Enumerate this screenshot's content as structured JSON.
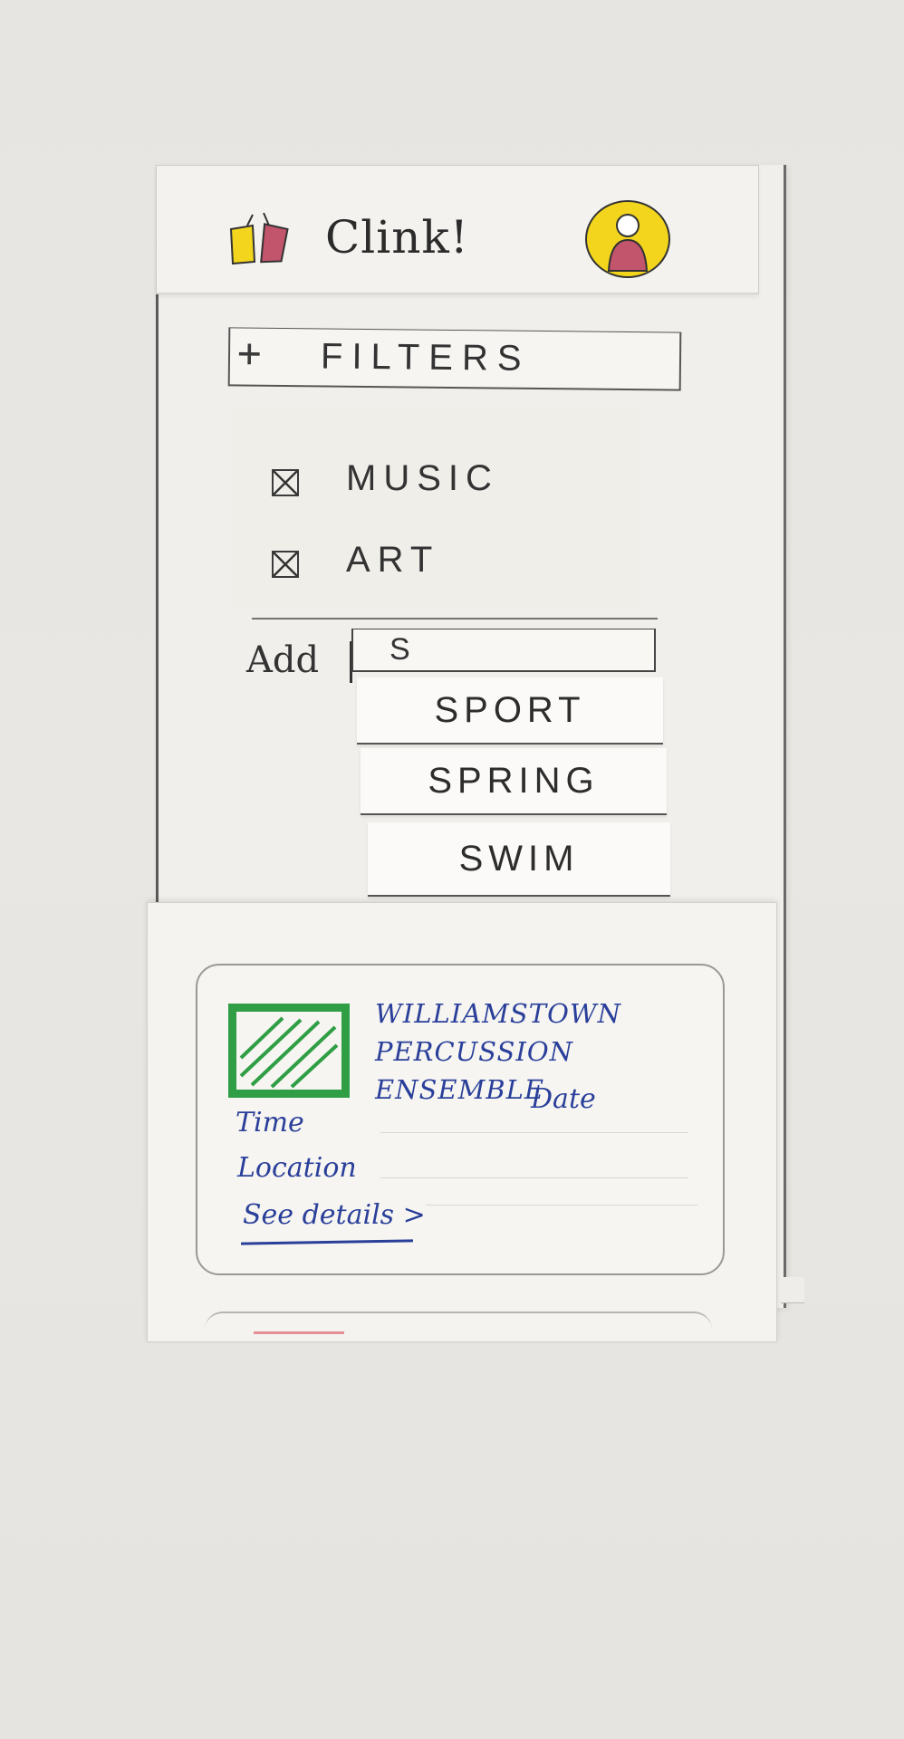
{
  "header": {
    "app_title": "Clink!"
  },
  "filters": {
    "toggle_symbol": "+",
    "title": "FILTERS",
    "items": [
      {
        "label": "MUSIC",
        "checked": true
      },
      {
        "label": "ART",
        "checked": true
      }
    ]
  },
  "add_tag": {
    "label": "Add",
    "input_value": "S",
    "suggestions": [
      "SPORT",
      "SPRING",
      "SWIM"
    ]
  },
  "event_card": {
    "title_line1": "WILLIAMSTOWN",
    "title_line2": "PERCUSSION ENSEMBLE",
    "date_label": "Date",
    "time_label": "Time",
    "location_label": "Location",
    "details_link": "See details >"
  },
  "colors": {
    "ink": "#333333",
    "event_text": "#2a3f9a",
    "thumbnail": "#2f9e44",
    "avatar_bg": "#f2d51c",
    "avatar_person": "#c2546b",
    "logo_cup_left": "#f2d51c",
    "logo_cup_right": "#c2546b"
  },
  "icons": {
    "logo": "clinking-cups-icon",
    "avatar": "user-avatar-icon",
    "checkbox": "checked-box-icon",
    "thumbnail": "event-image-icon"
  }
}
